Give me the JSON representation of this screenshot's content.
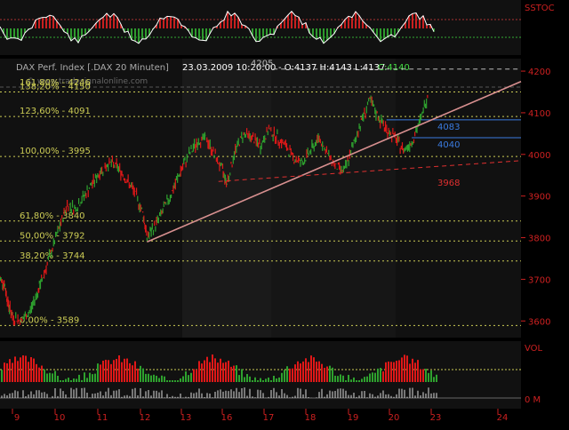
{
  "header": {
    "instrument": "DAX Perf. Index [.DAX  20 Minuten]",
    "timestamp": "23.03.2009 10:20:00",
    "ohlc": "- O:4137 H:4143 L:4137",
    "close": "C:4140",
    "watermark": "© www.tradesignalonline.com"
  },
  "colors": {
    "background": "#000000",
    "panel_bg": "#141414",
    "up": "#2ea12e",
    "down": "#e01818",
    "fib_line": "#cccc55",
    "trendline": "#d89090",
    "support_line": "#e03030",
    "blue_line": "#3a7be0",
    "axis_text": "#cc2020",
    "close_text": "#44dd44"
  },
  "top_indicator": {
    "label": "SSTOC"
  },
  "bottom_indicator": {
    "label": "VOL",
    "zero_label": "0 M"
  },
  "chart_data": {
    "type": "bar",
    "ylim": [
      3560,
      4230
    ],
    "y_ticks": [
      3600,
      3700,
      3800,
      3900,
      4000,
      4100,
      4200
    ],
    "x_tick_labels": [
      "9",
      "10",
      "11",
      "12",
      "13",
      "16",
      "17",
      "18",
      "19",
      "20",
      "23",
      "24"
    ],
    "fib_levels": [
      {
        "label": "161,80% - 4246",
        "value": 4246
      },
      {
        "label": "138,20% - 4150",
        "value": 4150
      },
      {
        "label": "123,60% - 4091",
        "value": 4091
      },
      {
        "label": "100,00% - 3995",
        "value": 3995
      },
      {
        "label": "61,80% - 3840",
        "value": 3840
      },
      {
        "label": "50,00% - 3792",
        "value": 3792
      },
      {
        "label": "38,20% - 3744",
        "value": 3744
      },
      {
        "label": "0,00% - 3589",
        "value": 3589
      }
    ],
    "annotations": [
      {
        "label": "4205",
        "value": 4205
      },
      {
        "label": "4083",
        "value": 4083
      },
      {
        "label": "4040",
        "value": 4040
      },
      {
        "label": "3968",
        "value": 3968
      }
    ],
    "price_path": [
      [
        0.0,
        3700
      ],
      [
        0.1,
        3690
      ],
      [
        0.2,
        3640
      ],
      [
        0.3,
        3610
      ],
      [
        0.5,
        3600
      ],
      [
        0.7,
        3620
      ],
      [
        0.9,
        3670
      ],
      [
        1.0,
        3700
      ],
      [
        1.2,
        3760
      ],
      [
        1.4,
        3820
      ],
      [
        1.6,
        3880
      ],
      [
        1.8,
        3870
      ],
      [
        2.0,
        3900
      ],
      [
        2.2,
        3930
      ],
      [
        2.4,
        3960
      ],
      [
        2.6,
        3980
      ],
      [
        2.8,
        3970
      ],
      [
        3.0,
        3940
      ],
      [
        3.2,
        3910
      ],
      [
        3.4,
        3860
      ],
      [
        3.5,
        3800
      ],
      [
        3.7,
        3830
      ],
      [
        3.9,
        3870
      ],
      [
        4.1,
        3910
      ],
      [
        4.3,
        3960
      ],
      [
        4.5,
        4000
      ],
      [
        4.7,
        4030
      ],
      [
        4.9,
        4040
      ],
      [
        5.1,
        4000
      ],
      [
        5.3,
        3960
      ],
      [
        5.4,
        3930
      ],
      [
        5.6,
        4010
      ],
      [
        5.8,
        4050
      ],
      [
        6.0,
        4040
      ],
      [
        6.2,
        4020
      ],
      [
        6.4,
        4060
      ],
      [
        6.6,
        4040
      ],
      [
        6.8,
        4020
      ],
      [
        7.0,
        3990
      ],
      [
        7.2,
        3980
      ],
      [
        7.4,
        4010
      ],
      [
        7.6,
        4040
      ],
      [
        7.8,
        4000
      ],
      [
        8.0,
        3970
      ],
      [
        8.2,
        3960
      ],
      [
        8.4,
        4020
      ],
      [
        8.6,
        4080
      ],
      [
        8.8,
        4130
      ],
      [
        9.0,
        4090
      ],
      [
        9.2,
        4060
      ],
      [
        9.4,
        4040
      ],
      [
        9.6,
        4010
      ],
      [
        9.8,
        4030
      ],
      [
        10.0,
        4080
      ],
      [
        10.2,
        4150
      ]
    ],
    "trendline": [
      [
        3.5,
        3790
      ],
      [
        12.4,
        4175
      ]
    ],
    "support_line": [
      [
        5.2,
        3935
      ],
      [
        12.4,
        3985
      ]
    ],
    "hline_4205_span": [
      6.5,
      12.4
    ],
    "hline_4083_span": [
      9.2,
      12.4
    ],
    "hline_4040_span": [
      9.8,
      12.4
    ],
    "hline_3968_span": [
      10.1,
      12.4
    ]
  }
}
